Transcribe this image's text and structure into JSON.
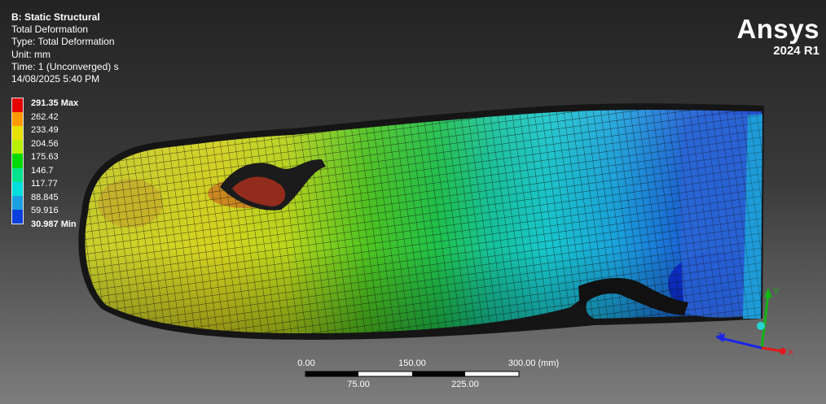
{
  "header": {
    "analysis": "B: Static Structural",
    "result": "Total Deformation",
    "type": "Type: Total Deformation",
    "unit": "Unit: mm",
    "time": "Time: 1 (Unconverged) s",
    "timestamp": "14/08/2025 5:40 PM"
  },
  "brand": {
    "name": "Ansys",
    "version": "2024 R1"
  },
  "legend": {
    "labels": [
      "291.35 Max",
      "262.42",
      "233.49",
      "204.56",
      "175.63",
      "146.7",
      "117.77",
      "88.845",
      "59.916",
      "30.987 Min"
    ],
    "colors": [
      "#e60000",
      "#ff9a00",
      "#e7e100",
      "#b9ef00",
      "#00d900",
      "#00e38e",
      "#00dede",
      "#1a9fe0",
      "#0a3fde",
      "#0000ee"
    ]
  },
  "scale_bar": {
    "top_labels": [
      "0.00",
      "150.00",
      "300.00 (mm)"
    ],
    "bottom_labels": [
      "75.00",
      "225.00"
    ]
  },
  "triad": {
    "x": "X",
    "y": "Y",
    "z": "Z",
    "x_color": "#e11a1a",
    "y_color": "#12b512",
    "z_color": "#1a26e6"
  }
}
